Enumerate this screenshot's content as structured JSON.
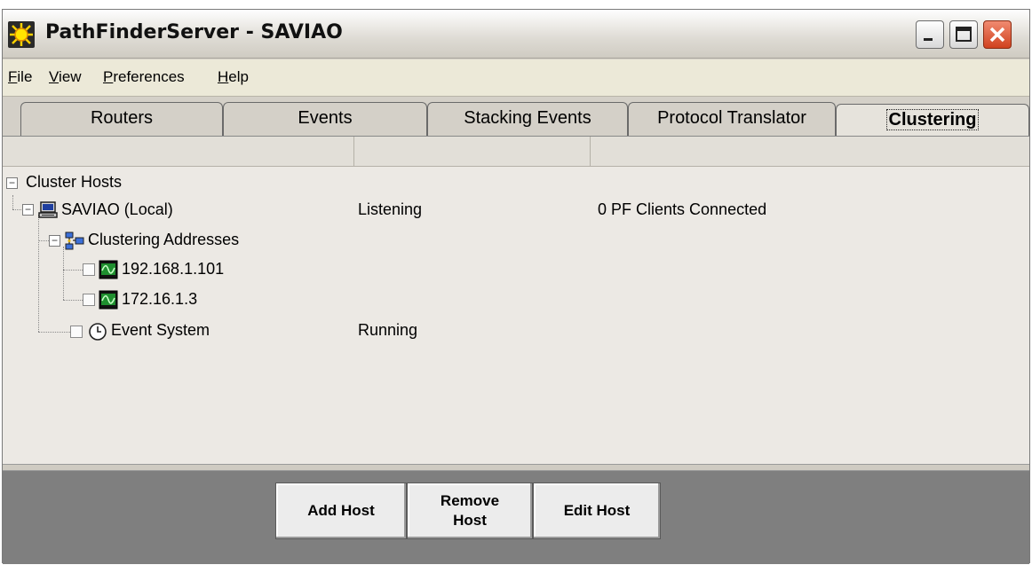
{
  "window": {
    "title": "PathFinderServer - SAVIAO",
    "app_icon": "sun-icon",
    "controls": [
      "minimize-icon",
      "maximize-icon",
      "close-icon"
    ],
    "close_color": "#d0421f"
  },
  "menu": [
    {
      "label": "File"
    },
    {
      "label": "View"
    },
    {
      "label": "Preferences"
    },
    {
      "label": "Help"
    }
  ],
  "tabs": [
    {
      "label": "Routers",
      "active": false
    },
    {
      "label": "Events",
      "active": false
    },
    {
      "label": "Stacking Events",
      "active": false
    },
    {
      "label": "Protocol Translator",
      "active": false
    },
    {
      "label": "Clustering",
      "active": true
    }
  ],
  "tree": {
    "root": {
      "label": "Cluster Hosts",
      "expanded": true
    },
    "host": {
      "label": "SAVIAO  (Local)",
      "status": "Listening",
      "clients": "0 PF Clients Connected",
      "icon": "computer-icon"
    },
    "addresses_group": {
      "label": "Clustering Addresses",
      "icon": "network-icon"
    },
    "addresses": [
      {
        "label": "192.168.1.101",
        "icon": "monitor-wave-icon"
      },
      {
        "label": "172.16.1.3",
        "icon": "monitor-wave-icon"
      }
    ],
    "event_system": {
      "label": "Event System",
      "status": "Running",
      "icon": "clock-icon"
    }
  },
  "buttons": {
    "add_host": "Add Host",
    "remove_host": "Remove Host",
    "edit_host": "Edit Host"
  }
}
